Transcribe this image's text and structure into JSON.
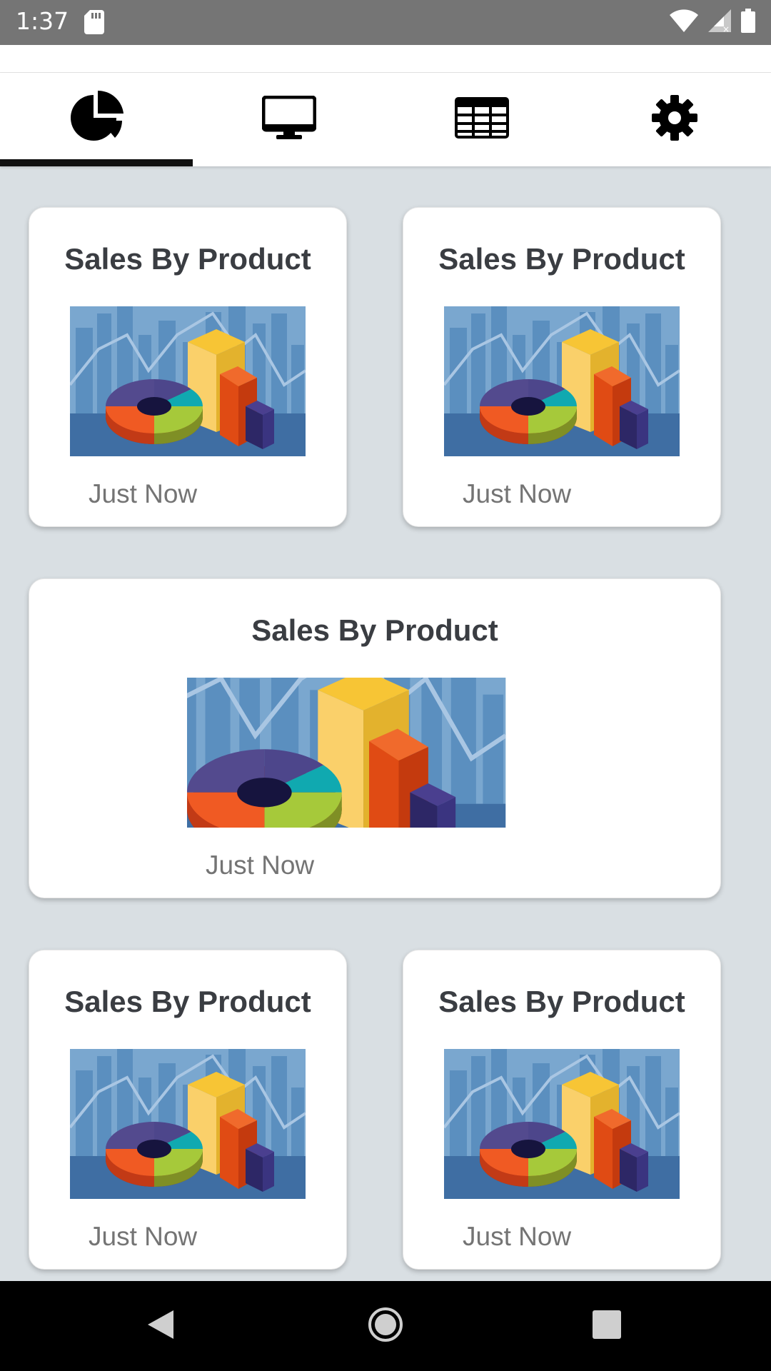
{
  "status_bar": {
    "time": "1:37"
  },
  "tabs": [
    {
      "name": "pie-chart-icon",
      "selected": true
    },
    {
      "name": "monitor-icon",
      "selected": false
    },
    {
      "name": "table-icon",
      "selected": false
    },
    {
      "name": "gear-icon",
      "selected": false
    }
  ],
  "cards": [
    {
      "title": "Sales By Product",
      "time": "Just Now"
    },
    {
      "title": "Sales By Product",
      "time": "Just Now"
    },
    {
      "title": "Sales By Product",
      "time": "Just Now"
    },
    {
      "title": "Sales By Product",
      "time": "Just Now"
    },
    {
      "title": "Sales By Product",
      "time": "Just Now"
    }
  ],
  "nav": {
    "icons": [
      "back-icon",
      "home-icon",
      "recents-icon"
    ]
  },
  "colors": {
    "accent": "#111111",
    "background": "#d9dfe3",
    "status_bar": "#757575"
  }
}
